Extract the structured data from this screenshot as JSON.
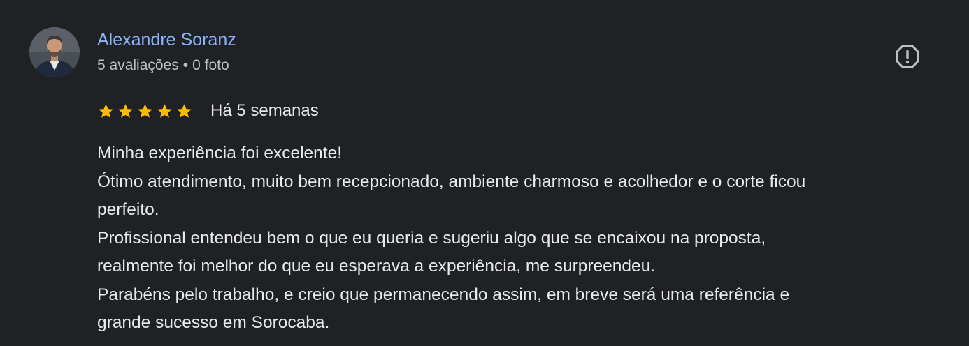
{
  "author": {
    "name": "Alexandre Soranz",
    "reviews_count": "5 avaliações",
    "separator": "•",
    "photos_count": "0 foto"
  },
  "review": {
    "rating": 5,
    "rating_max": 5,
    "date": "Há 5 semanas",
    "lines": [
      "Minha experiência foi excelente!",
      "Ótimo atendimento, muito bem recepcionado, ambiente charmoso e acolhedor e o corte ficou",
      "perfeito.",
      "Profissional entendeu bem o que eu queria e sugeriu algo que se encaixou na proposta,",
      "realmente foi melhor do que eu esperava a experiência, me surpreendeu.",
      "Parabéns pelo trabalho, e creio que permanecendo assim, em breve será uma referência e",
      "grande sucesso em Sorocaba."
    ]
  },
  "icons": {
    "report": "report-flag-icon",
    "star": "star-icon"
  },
  "colors": {
    "background": "#202124",
    "author_name": "#8ab4f8",
    "secondary_text": "#bdc1c6",
    "primary_text": "#e8eaed",
    "star": "#fbbc04",
    "report_icon": "#bdc1c6"
  }
}
